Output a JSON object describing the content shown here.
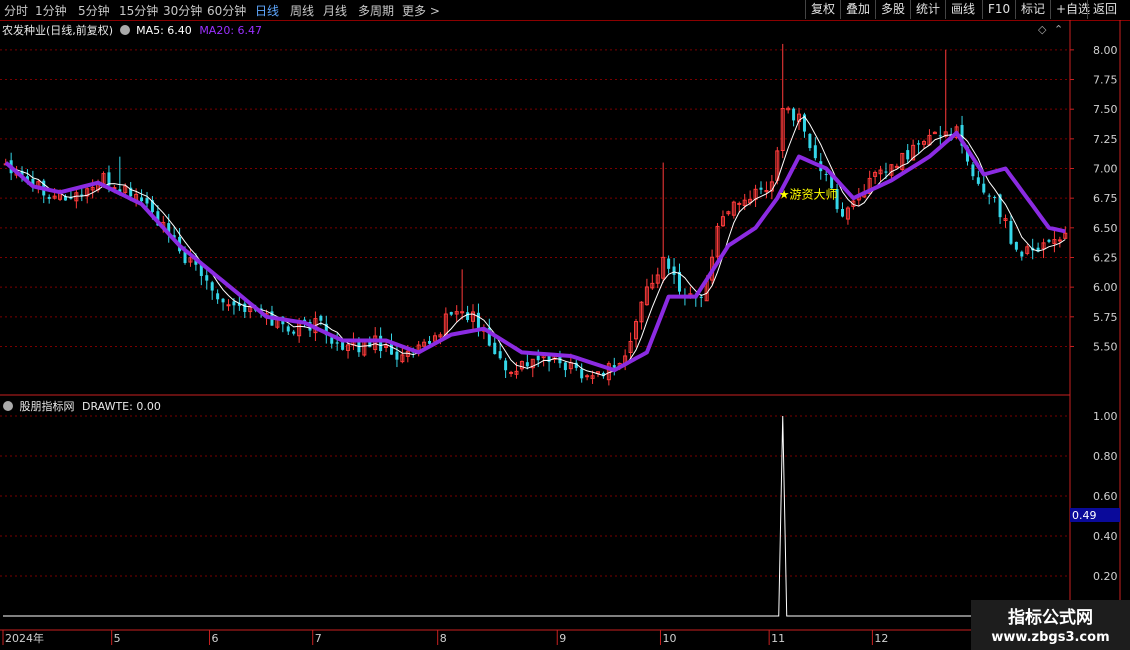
{
  "toolbar": {
    "periods": [
      "分时",
      "1分钟",
      "5分钟",
      "15分钟",
      "30分钟",
      "60分钟",
      "日线",
      "周线",
      "月线",
      "多周期",
      "更多 >"
    ],
    "active_period": "日线",
    "buttons": [
      "复权",
      "叠加",
      "多股",
      "统计",
      "画线",
      "F10",
      "标记",
      "+自选",
      "返回"
    ]
  },
  "main_panel": {
    "title": "农发种业(日线,前复权)",
    "ma5_label": "MA5: 6.40",
    "ma20_label": "MA20: 6.47",
    "annotation": "★游资大师",
    "colors": {
      "ma5": "#ffffff",
      "ma20": "#8b2be2",
      "up": "#ff3b3b",
      "down": "#35d6e8",
      "grid": "#7a0000",
      "axis": "#c82020",
      "annotation": "#ffff00"
    }
  },
  "sub_panel": {
    "title": "股朋指标网",
    "value_label": "DRAWTE: 0.00",
    "cursor_value": "0.49"
  },
  "watermark": {
    "line1": "指标公式网",
    "line2": "www.zbgs3.com"
  },
  "chart_data": [
    {
      "type": "candlestick",
      "title": "农发种业(日线,前复权)",
      "y_ticks": [
        5.5,
        5.75,
        6.0,
        6.25,
        6.5,
        6.75,
        7.0,
        7.25,
        7.5,
        7.75,
        8.0
      ],
      "ylim": [
        5.15,
        8.1
      ],
      "x_labels": [
        "2024年",
        "5",
        "6",
        "7",
        "8",
        "9",
        "10",
        "11",
        "12"
      ],
      "x_label_days": [
        0,
        20,
        38,
        57,
        80,
        102,
        121,
        141,
        160
      ],
      "n_days": 196,
      "series": [
        {
          "name": "MA5",
          "value": 6.4
        },
        {
          "name": "MA20",
          "value": 6.47
        }
      ],
      "close_keypoints": [
        {
          "day": 0,
          "price": 7.05
        },
        {
          "day": 8,
          "price": 6.8
        },
        {
          "day": 12,
          "price": 6.75
        },
        {
          "day": 18,
          "price": 6.9
        },
        {
          "day": 25,
          "price": 6.75
        },
        {
          "day": 32,
          "price": 6.3
        },
        {
          "day": 40,
          "price": 5.9
        },
        {
          "day": 48,
          "price": 5.75
        },
        {
          "day": 52,
          "price": 5.65
        },
        {
          "day": 58,
          "price": 5.7
        },
        {
          "day": 62,
          "price": 5.45
        },
        {
          "day": 68,
          "price": 5.55
        },
        {
          "day": 73,
          "price": 5.4
        },
        {
          "day": 78,
          "price": 5.5
        },
        {
          "day": 82,
          "price": 5.8
        },
        {
          "day": 86,
          "price": 5.75
        },
        {
          "day": 92,
          "price": 5.3
        },
        {
          "day": 98,
          "price": 5.4
        },
        {
          "day": 103,
          "price": 5.35
        },
        {
          "day": 108,
          "price": 5.25
        },
        {
          "day": 114,
          "price": 5.4
        },
        {
          "day": 118,
          "price": 6.0
        },
        {
          "day": 121,
          "price": 6.2
        },
        {
          "day": 125,
          "price": 5.95
        },
        {
          "day": 128,
          "price": 5.9
        },
        {
          "day": 132,
          "price": 6.65
        },
        {
          "day": 137,
          "price": 6.75
        },
        {
          "day": 141,
          "price": 6.85
        },
        {
          "day": 143,
          "price": 7.55
        },
        {
          "day": 146,
          "price": 7.4
        },
        {
          "day": 150,
          "price": 7.0
        },
        {
          "day": 154,
          "price": 6.6
        },
        {
          "day": 158,
          "price": 6.85
        },
        {
          "day": 163,
          "price": 7.0
        },
        {
          "day": 168,
          "price": 7.2
        },
        {
          "day": 172,
          "price": 7.3
        },
        {
          "day": 175,
          "price": 7.3
        },
        {
          "day": 178,
          "price": 6.9
        },
        {
          "day": 182,
          "price": 6.75
        },
        {
          "day": 186,
          "price": 6.3
        },
        {
          "day": 190,
          "price": 6.35
        },
        {
          "day": 195,
          "price": 6.45
        }
      ],
      "ma20_keypoints": [
        {
          "day": 0,
          "price": 7.05
        },
        {
          "day": 5,
          "price": 6.85
        },
        {
          "day": 10,
          "price": 6.8
        },
        {
          "day": 17,
          "price": 6.88
        },
        {
          "day": 25,
          "price": 6.7
        },
        {
          "day": 32,
          "price": 6.35
        },
        {
          "day": 40,
          "price": 6.05
        },
        {
          "day": 48,
          "price": 5.75
        },
        {
          "day": 55,
          "price": 5.7
        },
        {
          "day": 62,
          "price": 5.55
        },
        {
          "day": 70,
          "price": 5.55
        },
        {
          "day": 76,
          "price": 5.45
        },
        {
          "day": 82,
          "price": 5.6
        },
        {
          "day": 88,
          "price": 5.65
        },
        {
          "day": 95,
          "price": 5.45
        },
        {
          "day": 104,
          "price": 5.42
        },
        {
          "day": 112,
          "price": 5.3
        },
        {
          "day": 118,
          "price": 5.45
        },
        {
          "day": 122,
          "price": 5.92
        },
        {
          "day": 127,
          "price": 5.92
        },
        {
          "day": 133,
          "price": 6.35
        },
        {
          "day": 138,
          "price": 6.5
        },
        {
          "day": 142,
          "price": 6.75
        },
        {
          "day": 146,
          "price": 7.1
        },
        {
          "day": 151,
          "price": 7.0
        },
        {
          "day": 156,
          "price": 6.75
        },
        {
          "day": 163,
          "price": 6.9
        },
        {
          "day": 170,
          "price": 7.1
        },
        {
          "day": 175,
          "price": 7.3
        },
        {
          "day": 180,
          "price": 6.95
        },
        {
          "day": 184,
          "price": 7.0
        },
        {
          "day": 188,
          "price": 6.75
        },
        {
          "day": 192,
          "price": 6.5
        },
        {
          "day": 195,
          "price": 6.47
        }
      ],
      "spikes": [
        {
          "day": 143,
          "high": 8.05
        },
        {
          "day": 173,
          "high": 8.0
        },
        {
          "day": 84,
          "high": 6.15
        },
        {
          "day": 121,
          "high": 7.05
        },
        {
          "day": 21,
          "high": 7.1
        }
      ],
      "annotation": {
        "day": 143,
        "price": 6.78,
        "text": "★游资大师"
      }
    },
    {
      "type": "line",
      "title": "股朋指标网",
      "series": [
        {
          "name": "DRAWTE",
          "value": 0.0
        }
      ],
      "y_ticks": [
        0.2,
        0.4,
        0.6,
        0.8,
        1.0
      ],
      "ylim": [
        -0.05,
        1.08
      ],
      "spike": {
        "day": 143,
        "value": 1.0
      }
    }
  ]
}
